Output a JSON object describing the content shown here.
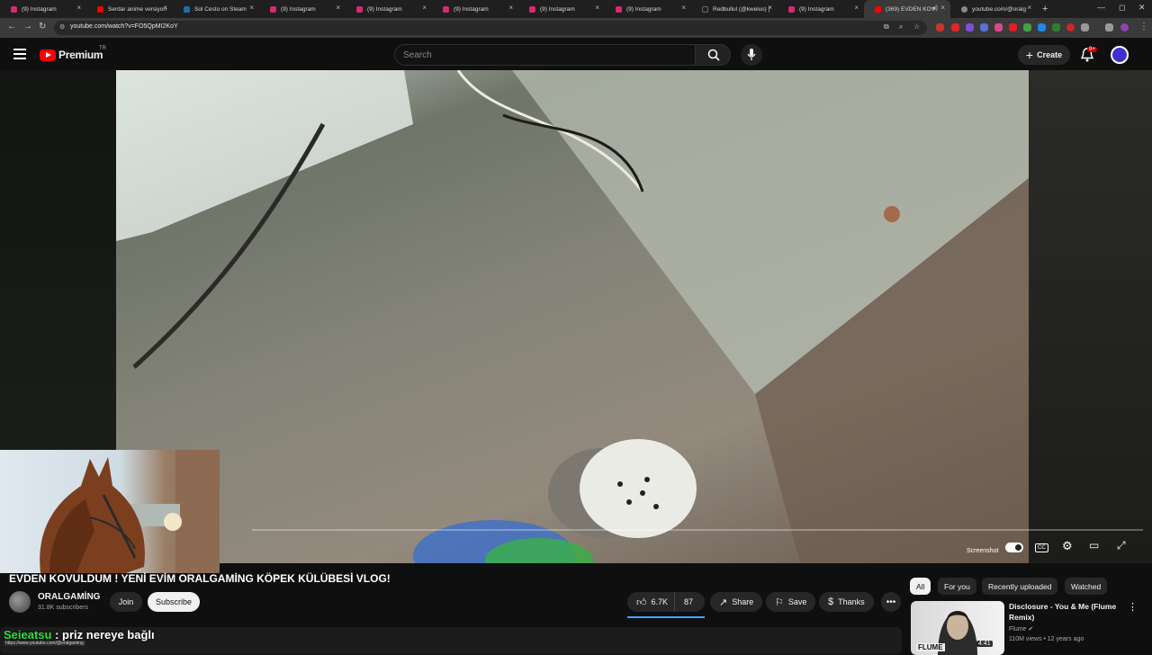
{
  "browser": {
    "tabs": [
      {
        "title": "(9) Instagram",
        "color": "#d62976"
      },
      {
        "title": "Serdar anime versiyon",
        "color": "#ff0000"
      },
      {
        "title": "Sol Cesto on Steam",
        "color": "#1b6fa8"
      },
      {
        "title": "(9) Instagram",
        "color": "#d62976"
      },
      {
        "title": "(9) Instagram",
        "color": "#d62976"
      },
      {
        "title": "(9) Instagram",
        "color": "#d62976"
      },
      {
        "title": "(9) Instagram",
        "color": "#d62976"
      },
      {
        "title": "(9) Instagram",
        "color": "#d62976"
      },
      {
        "title": "Redbullul (@kwelus) |",
        "color": "#222222"
      },
      {
        "title": "(9) Instagram",
        "color": "#d62976"
      },
      {
        "title": "(369) EVDEN KOV",
        "color": "#ff0000"
      },
      {
        "title": "youtube.com/@oralg",
        "color": "#888888"
      }
    ],
    "url": "youtube.com/watch?v=FO5QpMI2KoY"
  },
  "header": {
    "logo_text": "Premium",
    "logo_country": "TR",
    "search_placeholder": "Search",
    "create_label": "Create",
    "notif_badge": "9+"
  },
  "player": {
    "screenshot_label": "Screenshot",
    "progress": 0.0
  },
  "video": {
    "title": "EVDEN KOVULDUM ! YENİ EVİM ORALGAMİNG KÖPEK KÜLÜBESİ VLOG!",
    "channel_name": "ORALGAMİNG",
    "channel_subs": "31.8K subscribers",
    "join_label": "Join",
    "subscribe_label": "Subscribe",
    "likes": "6.7K",
    "dislikes": "87",
    "share_label": "Share",
    "save_label": "Save",
    "thanks_label": "Thanks"
  },
  "overlay": {
    "caption_name": "Seieatsu",
    "caption_text": ": priz nereye bağlı",
    "status_url": "https://www.youtube.com/@oralgaming"
  },
  "chips": [
    "All",
    "For you",
    "Recently uploaded",
    "Watched"
  ],
  "recommendation": {
    "title": "Disclosure - You & Me (Flume Remix)",
    "channel": "Flume",
    "meta": "110M views • 12 years ago",
    "duration": "4:41",
    "thumb_text": "FLUME"
  }
}
